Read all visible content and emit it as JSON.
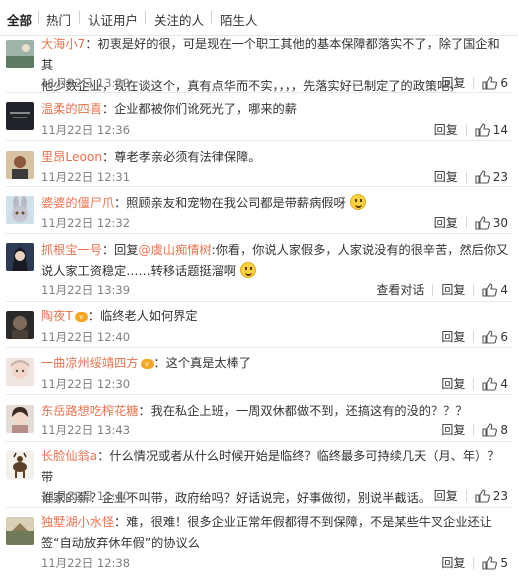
{
  "tabs": [
    "全部",
    "热门",
    "认证用户",
    "关注的人",
    "陌生人"
  ],
  "labels": {
    "reply": "回复",
    "view_conversation": "查看对话",
    "like_icon": "thumb-up-icon",
    "vip_badge": "v"
  },
  "colors": {
    "username": "#eb7350",
    "meta": "#808080",
    "text": "#333333"
  },
  "comments": [
    {
      "user": "大海小7",
      "lines": [
        "：初衷是好的很，可是现在一个职工其他的基本保障都落实不了，除了国企和其",
        "他少数企业，现在谈这个，真有点华而不实，，，，先落实好已制定了的政策吧，"
      ],
      "time": "11月22日 13:29",
      "likes": "6",
      "avatar": "landscape"
    },
    {
      "user": "温柔的四喜",
      "lines": [
        "：企业都被你们讹死光了，哪来的薪"
      ],
      "time": "11月22日 12:36",
      "likes": "14",
      "avatar": "dark"
    },
    {
      "user": "里昂Leoon",
      "lines": [
        "：尊老孝亲必须有法律保障。"
      ],
      "time": "11月22日 12:31",
      "likes": "23",
      "avatar": "person"
    },
    {
      "user": "婆婆的僵尸爪",
      "lines": [
        "：照顾亲友和宠物在我公司都是带薪病假呀"
      ],
      "time": "11月22日 12:32",
      "likes": "30",
      "avatar": "bunny"
    },
    {
      "user": "抓根宝一号",
      "reply_prefix": "：回复",
      "reply_to": "@虞山痴情树",
      "lines": [
        ":你看，你说人家假多，人家说没有的很辛苦，然后你又",
        "说人家工资稳定……转移话题挺溜啊"
      ],
      "time": "11月22日 13:39",
      "likes": "4",
      "has_conversation": true,
      "avatar": "anime"
    },
    {
      "user": "陶夜T",
      "lines": [
        "：临终老人如何界定"
      ],
      "time": "11月22日 12:40",
      "likes": "6",
      "avatar": "knight",
      "vip": true
    },
    {
      "user": "一曲凉州绥靖四方",
      "lines": [
        "：这个真是太棒了"
      ],
      "time": "11月22日 12:30",
      "likes": "4",
      "avatar": "doll",
      "vip": true
    },
    {
      "user": "东岳路想吃榨花糖",
      "lines": [
        "：我在私企上班，一周双休都做不到，还搞这有的没的？？？"
      ],
      "time": "11月22日 13:43",
      "likes": "8",
      "avatar": "girl"
    },
    {
      "user": "长脸仙翁a",
      "lines": [
        "：什么情况或者从什么时候开始是临终？临终最多可持续几天（月、年）？带",
        "谁家的薪？企业不叫带，政府给吗？好话说完，好事做彻，别说半截话。"
      ],
      "time": "11月22日 12:40",
      "likes": "23",
      "avatar": "deer"
    },
    {
      "user": "独墅湖小水怪",
      "lines": [
        "：难，很难！很多企业正常年假都得不到保障，不是某些牛叉企业还让",
        "签“自动放弃休年假”的协议么"
      ],
      "time": "11月22日 12:38",
      "likes": "5",
      "avatar": "boat"
    }
  ]
}
